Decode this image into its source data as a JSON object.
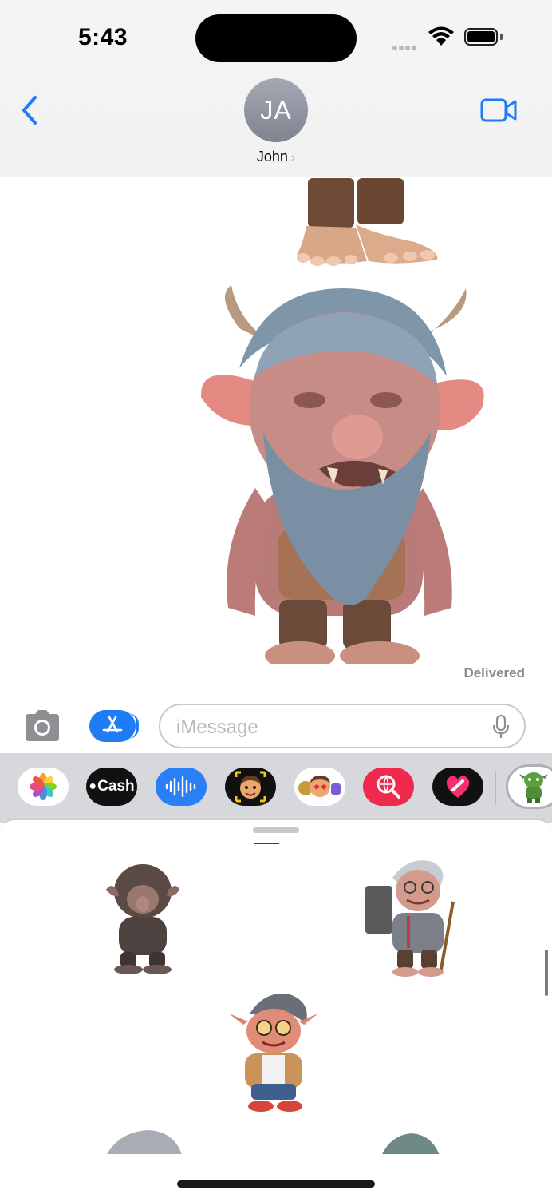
{
  "status": {
    "time": "5:43"
  },
  "header": {
    "avatar_initials": "JA",
    "contact_name": "John",
    "chevron": "›"
  },
  "conversation": {
    "delivered_label": "Delivered"
  },
  "input": {
    "placeholder": "iMessage"
  },
  "app_strip": {
    "apps": [
      {
        "name": "photos-app",
        "label": ""
      },
      {
        "name": "apple-cash-app",
        "label": "Cash"
      },
      {
        "name": "audio-message-app",
        "label": ""
      },
      {
        "name": "memoji-app",
        "label": ""
      },
      {
        "name": "memoji-stickers-app",
        "label": ""
      },
      {
        "name": "images-search-app",
        "label": ""
      },
      {
        "name": "digital-touch-app",
        "label": ""
      },
      {
        "name": "troll-stickers-app",
        "label": ""
      }
    ]
  },
  "colors": {
    "accent": "#1f7cf5",
    "cash_bg": "#111111",
    "images_bg": "#f0294f"
  },
  "icons": [
    "back-chevron-icon",
    "video-camera-icon",
    "camera-icon",
    "app-store-icon",
    "microphone-icon",
    "wifi-icon",
    "battery-icon"
  ]
}
